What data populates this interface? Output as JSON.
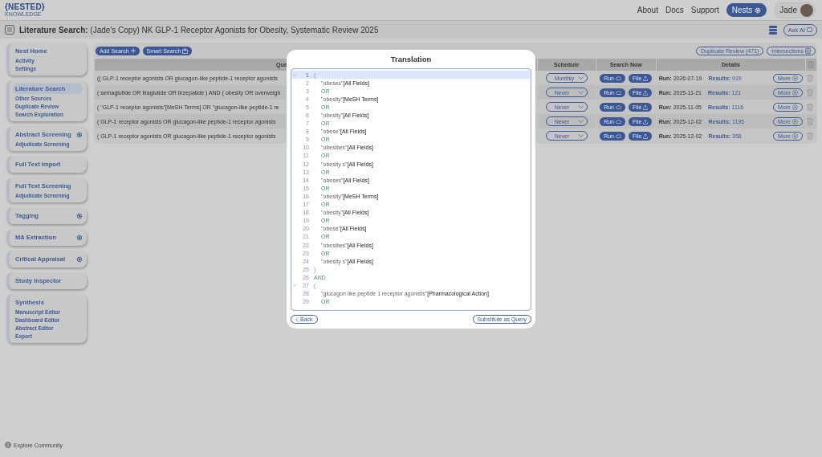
{
  "logo": {
    "brand": "{NESTED}",
    "tagline": "KNOWLEDGE"
  },
  "nav": {
    "links": [
      "About",
      "Docs",
      "Support"
    ],
    "nests_button": "Nests",
    "user": "Jade"
  },
  "page_title": "**Literature Search:** (Jade's Copy) NK GLP-1 Receptor Agonists for Obesity, Systematic Review 2025",
  "ask_ai_button": "Ask AI",
  "sidebar": {
    "groups": [
      {
        "title": "Nest Home",
        "selected": false,
        "settings": false,
        "items": [
          {
            "label": "Activity",
            "selected": false
          },
          {
            "label": "Settings",
            "selected": false
          }
        ]
      },
      {
        "title": "Literature Search",
        "selected": true,
        "settings": false,
        "items": [
          {
            "label": "Other Sources",
            "selected": false
          },
          {
            "label": "Duplicate Review",
            "selected": false
          },
          {
            "label": "Search Exploration",
            "selected": false
          }
        ]
      },
      {
        "title": "Abstract Screening",
        "selected": false,
        "settings": true,
        "items": [
          {
            "label": "Adjudicate Screening",
            "selected": false
          }
        ]
      },
      {
        "title": "Full Text Import",
        "selected": false,
        "settings": false
      },
      {
        "title": "Full Text Screening",
        "selected": false,
        "settings": false,
        "items": [
          {
            "label": "Adjudicate Screening",
            "selected": false
          }
        ]
      },
      {
        "title": "Tagging",
        "selected": false,
        "settings": true
      },
      {
        "title": "MA Extraction",
        "selected": false,
        "settings": true
      },
      {
        "title": "Critical Appraisal",
        "selected": false,
        "settings": true
      },
      {
        "title": "Study Inspector",
        "selected": false,
        "settings": false
      },
      {
        "title": "Synthesis",
        "selected": false,
        "settings": false,
        "items": [
          {
            "label": "Manuscript Editor",
            "selected": false
          },
          {
            "label": "Dashboard Editor",
            "selected": false
          },
          {
            "label": "Abstract Editor",
            "selected": false
          },
          {
            "label": "Export",
            "selected": false
          }
        ]
      }
    ],
    "footer_link": "Explore Community"
  },
  "searches": {
    "buttons": [
      "Add Search",
      "Smart Search"
    ],
    "duplicate_review_button": "Duplicate Review (471)",
    "intersections_button": "Intersections",
    "columns": [
      "Que",
      "Schedule",
      "Search Now",
      "Details"
    ],
    "rows": [
      {
        "query": "(( GLP-1 receptor agonists OR glucagon-like peptide-1 receptor agonists",
        "schedule": "Monthly",
        "run_button": "Run",
        "file_button": "File",
        "run": "**Run:** 2026-07-19",
        "results": "**Results:** 919",
        "more_button": "More"
      },
      {
        "query": "( semaglutide OR liraglutide OR tirzepatide ) AND ( obesity OR overweigh",
        "schedule": "Never",
        "run_button": "Run",
        "file_button": "File",
        "run": "**Run:** 2025-11-21",
        "results": "**Results:** 121",
        "more_button": "More"
      },
      {
        "query": "( \"GLP-1 receptor agonists\"[MeSH Terms] OR \"glucagon-like peptide-1 re",
        "schedule": "Never",
        "run_button": "Run",
        "file_button": "File",
        "run": "**Run:** 2025-11-05",
        "results": "**Results:** 1116",
        "more_button": "More"
      },
      {
        "query": "( GLP-1 receptor agonists OR glucagon-like peptide-1 receptor agonists",
        "schedule": "Never",
        "run_button": "Run",
        "file_button": "File",
        "run": "**Run:** 2025-12-02",
        "results": "**Results:** 1195",
        "more_button": "More"
      },
      {
        "query": "( GLP-1 receptor agonists OR glucagon-like peptide-1 receptor agonists",
        "schedule": "Never",
        "run_button": "Run",
        "file_button": "File",
        "run": "**Run:** 2025-12-02",
        "results": "**Results:** 358",
        "more_button": "More"
      }
    ]
  },
  "translation_dialog": {
    "title": "Translation",
    "back_button": "Back",
    "substitute_button": "Substitute as Query",
    "lines": [
      {
        "number": "1",
        "kind": "open",
        "text": "(",
        "selected": true
      },
      {
        "number": "2",
        "kind": "term",
        "term": "\"obeses\"",
        "field": "[All Fields]",
        "selected": false
      },
      {
        "number": "3",
        "kind": "operator",
        "text": "OR",
        "selected": false
      },
      {
        "number": "4",
        "kind": "term",
        "term": "\"obesity\"",
        "field": "[MeSH Terms]",
        "selected": false
      },
      {
        "number": "5",
        "kind": "operator",
        "text": "OR",
        "selected": false
      },
      {
        "number": "6",
        "kind": "term",
        "term": "\"obesity\"",
        "field": "[All Fields]",
        "selected": false
      },
      {
        "number": "7",
        "kind": "operator",
        "text": "OR",
        "selected": false
      },
      {
        "number": "8",
        "kind": "term",
        "term": "\"obese\"",
        "field": "[All Fields]",
        "selected": false
      },
      {
        "number": "9",
        "kind": "operator",
        "text": "OR",
        "selected": false
      },
      {
        "number": "10",
        "kind": "term",
        "term": "\"obesities\"",
        "field": "[All Fields]",
        "selected": false
      },
      {
        "number": "11",
        "kind": "operator",
        "text": "OR",
        "selected": false
      },
      {
        "number": "12",
        "kind": "term",
        "term": "\"obesity s\"",
        "field": "[All Fields]",
        "selected": false
      },
      {
        "number": "13",
        "kind": "operator",
        "text": "OR",
        "selected": false
      },
      {
        "number": "14",
        "kind": "term",
        "term": "\"obeses\"",
        "field": "[All Fields]",
        "selected": false
      },
      {
        "number": "15",
        "kind": "operator",
        "text": "OR",
        "selected": false
      },
      {
        "number": "16",
        "kind": "term",
        "term": "\"obesity\"",
        "field": "[MeSH Terms]",
        "selected": false
      },
      {
        "number": "17",
        "kind": "operator",
        "text": "OR",
        "selected": false
      },
      {
        "number": "18",
        "kind": "term",
        "term": "\"obesity\"",
        "field": "[All Fields]",
        "selected": false
      },
      {
        "number": "19",
        "kind": "operator",
        "text": "OR",
        "selected": false
      },
      {
        "number": "20",
        "kind": "term",
        "term": "\"obese\"",
        "field": "[All Fields]",
        "selected": false
      },
      {
        "number": "21",
        "kind": "operator",
        "text": "OR",
        "selected": false
      },
      {
        "number": "22",
        "kind": "term",
        "term": "\"obesities\"",
        "field": "[All Fields]",
        "selected": false
      },
      {
        "number": "23",
        "kind": "operator",
        "text": "OR",
        "selected": false
      },
      {
        "number": "24",
        "kind": "term",
        "term": "\"obesity s\"",
        "field": "[All Fields]",
        "selected": false
      },
      {
        "number": "25",
        "kind": "close",
        "text": ")",
        "selected": false
      },
      {
        "number": "26",
        "kind": "operator",
        "text": "AND",
        "selected": false
      },
      {
        "number": "27",
        "kind": "open",
        "text": "(",
        "selected": false
      },
      {
        "number": "28",
        "kind": "term",
        "term": "\"glucagon like peptide 1 receptor agonists\"",
        "field": "[Pharmacological Action]",
        "selected": false
      },
      {
        "number": "29",
        "kind": "operator",
        "text": "OR",
        "selected": false
      }
    ]
  }
}
